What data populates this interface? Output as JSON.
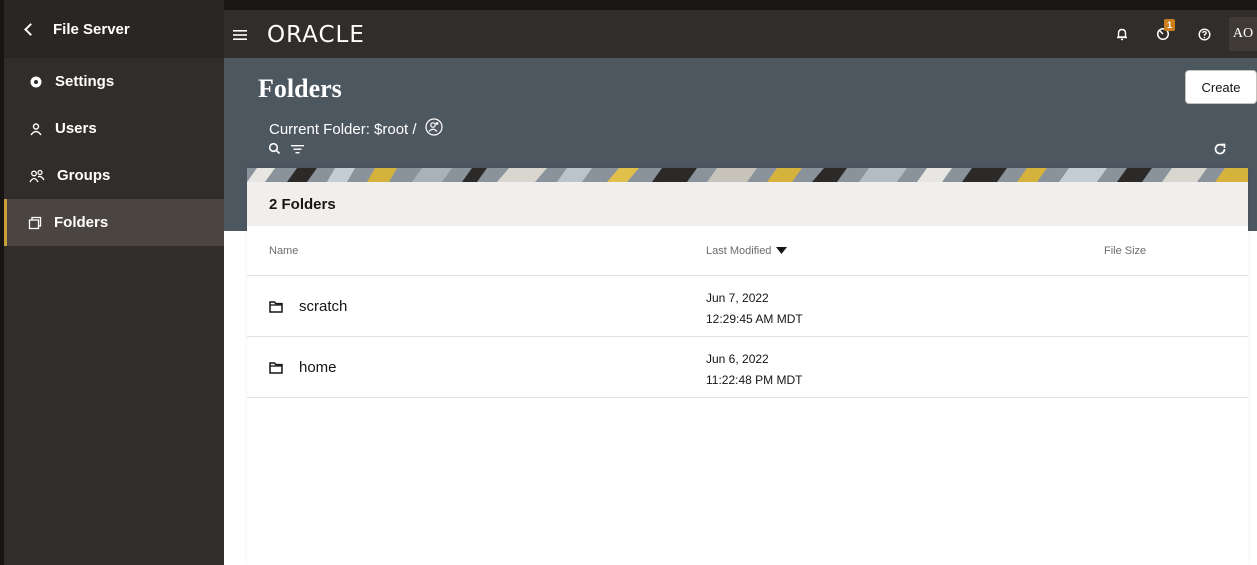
{
  "sidebar": {
    "back_label": "File Server",
    "items": [
      {
        "label": "Settings",
        "icon": "gear-icon"
      },
      {
        "label": "Users",
        "icon": "user-icon"
      },
      {
        "label": "Groups",
        "icon": "group-icon"
      },
      {
        "label": "Folders",
        "icon": "folders-icon",
        "active": true
      }
    ]
  },
  "topbar": {
    "logo": "ORACLE",
    "notification_badge": "1",
    "avatar_initials": "AO"
  },
  "header": {
    "title": "Folders",
    "create_label": "Create",
    "current_folder_label": "Current Folder: $root /"
  },
  "card": {
    "count_label": "2 Folders",
    "columns": {
      "name": "Name",
      "last_modified": "Last Modified",
      "file_size": "File Size"
    },
    "rows": [
      {
        "name": "scratch",
        "date": "Jun 7, 2022",
        "time": "12:29:45 AM MDT"
      },
      {
        "name": "home",
        "date": "Jun 6, 2022",
        "time": "11:22:48 PM MDT"
      }
    ]
  },
  "colors": {
    "sidebar_bg": "#312d2a",
    "header_bg": "#4d5760",
    "active_accent": "#c9a13c",
    "badge": "#c9801c"
  }
}
